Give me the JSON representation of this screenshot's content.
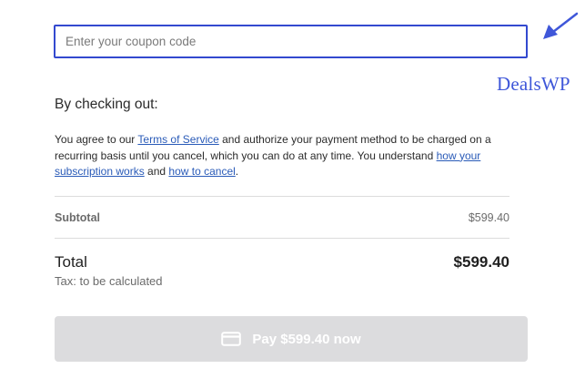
{
  "coupon": {
    "placeholder": "Enter your coupon code",
    "value": ""
  },
  "watermark": {
    "text": "DealsWP",
    "arrow_icon": "arrow-pointer-icon",
    "color": "#3f57d9"
  },
  "checkout": {
    "heading": "By checking out:",
    "terms": {
      "text_1": "You agree to our ",
      "link_terms": "Terms of Service",
      "text_2": " and authorize your payment method to be charged on a recurring basis until you cancel, which you can do at any time. You understand ",
      "link_how_works": "how your subscription works",
      "text_3": " and ",
      "link_cancel": "how to cancel",
      "text_4": "."
    }
  },
  "summary": {
    "subtotal_label": "Subtotal",
    "subtotal_value": "$599.40",
    "total_label": "Total",
    "total_value": "$599.40",
    "tax_note": "Tax: to be calculated"
  },
  "pay_button": {
    "label": "Pay $599.40 now",
    "icon": "credit-card-icon",
    "state": "disabled"
  },
  "colors": {
    "accent": "#3349cf",
    "link": "#2a5bb8",
    "button_bg": "#dcdcde"
  }
}
